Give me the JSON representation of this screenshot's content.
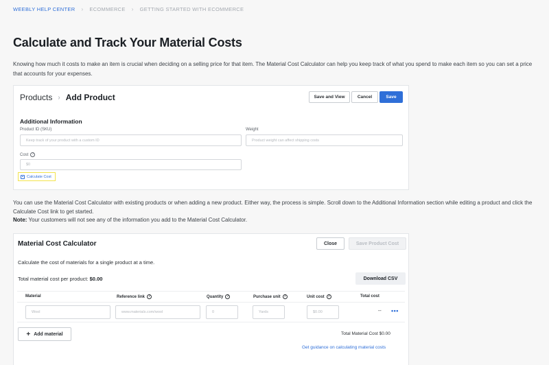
{
  "breadcrumb": {
    "home": "WEEBLY HELP CENTER",
    "section": "ECOMMERCE",
    "page": "GETTING STARTED WITH ECOMMERCE"
  },
  "title": "Calculate and Track Your Material Costs",
  "intro": "Knowing how much it costs to make an item is crucial when deciding on a selling price for that item. The Material Cost Calculator can help you keep track of what you spend to make each item so you can set a price that accounts for your expenses.",
  "add_product": {
    "header_products": "Products",
    "header_add": "Add Product",
    "save_and_view": "Save and View",
    "cancel": "Cancel",
    "save": "Save",
    "section_title": "Additional Information",
    "sku_label": "Product ID (SKU)",
    "sku_placeholder": "Keep track of your product with a custom ID",
    "weight_label": "Weight",
    "weight_placeholder": "Product weight can affect shipping costs",
    "cost_label": "Cost",
    "cost_placeholder": "$0",
    "calculate_cost": "Calculate Cost"
  },
  "body": {
    "line1": "You can use the Material Cost Calculator with existing products or when adding a new product. Either way, the process is simple. Scroll down to the Additional Information section while editing a product and click the Calculate Cost link to get started.",
    "note_label": "Note:",
    "note_text": " Your customers will not see any of the information you add to the Material Cost Calculator."
  },
  "calculator": {
    "title": "Material Cost Calculator",
    "close": "Close",
    "save_product_cost": "Save Product Cost",
    "description": "Calculate the cost of materials for a single product at a time.",
    "total_label": "Total material cost per product: ",
    "total_value": "$0.00",
    "download_csv": "Download CSV",
    "columns": {
      "material": "Material",
      "reference_link": "Reference link",
      "quantity": "Quantity",
      "purchase_unit": "Purchase unit",
      "unit_cost": "Unit cost",
      "total_cost": "Total cost"
    },
    "row": {
      "material_placeholder": "Wool",
      "link_placeholder": "www.materials.com/wool",
      "quantity_placeholder": "0",
      "unit_placeholder": "Yards",
      "unit_cost_placeholder": "$0.00",
      "total": "--",
      "more": "•••"
    },
    "add_material": "Add material",
    "total_material_cost": "Total Material Cost $0.00",
    "guidance": "Get guidance on calculating material costs"
  },
  "colors": {
    "accent": "#2f6fd8",
    "highlight": "#f2e34a",
    "background": "#f7f7f7"
  }
}
